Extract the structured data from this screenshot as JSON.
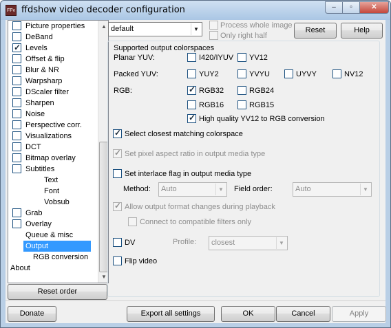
{
  "window": {
    "title": "ffdshow video decoder configuration",
    "icon_text": "FFv",
    "minimize": "–",
    "maximize": "▫",
    "close": "✕"
  },
  "tree": {
    "items": [
      {
        "label": "Picture properties",
        "checkbox": true,
        "checked": false
      },
      {
        "label": "DeBand",
        "checkbox": true,
        "checked": false
      },
      {
        "label": "Levels",
        "checkbox": true,
        "checked": true
      },
      {
        "label": "Offset & flip",
        "checkbox": true,
        "checked": false
      },
      {
        "label": "Blur & NR",
        "checkbox": true,
        "checked": false
      },
      {
        "label": "Warpsharp",
        "checkbox": true,
        "checked": false
      },
      {
        "label": "DScaler filter",
        "checkbox": true,
        "checked": false
      },
      {
        "label": "Sharpen",
        "checkbox": true,
        "checked": false
      },
      {
        "label": "Noise",
        "checkbox": true,
        "checked": false
      },
      {
        "label": "Perspective corr.",
        "checkbox": true,
        "checked": false
      },
      {
        "label": "Visualizations",
        "checkbox": true,
        "checked": false
      },
      {
        "label": "DCT",
        "checkbox": true,
        "checked": false
      },
      {
        "label": "Bitmap overlay",
        "checkbox": true,
        "checked": false
      },
      {
        "label": "Subtitles",
        "checkbox": true,
        "checked": false
      },
      {
        "label": "Text",
        "checkbox": false
      },
      {
        "label": "Font",
        "checkbox": false
      },
      {
        "label": "Vobsub",
        "checkbox": false
      },
      {
        "label": "Grab",
        "checkbox": true,
        "checked": false
      },
      {
        "label": "Overlay",
        "checkbox": true,
        "checked": false
      },
      {
        "label": "Queue & misc",
        "checkbox": false
      },
      {
        "label": "Output",
        "checkbox": false,
        "selected": true
      },
      {
        "label": "RGB conversion",
        "checkbox": false
      },
      {
        "label": "About",
        "checkbox": false
      }
    ],
    "scroll_up": "▲",
    "scroll_down": "▼"
  },
  "buttons": {
    "reset_order": "Reset order",
    "reset": "Reset",
    "help": "Help",
    "donate": "Donate",
    "export_all": "Export all settings",
    "ok": "OK",
    "cancel": "Cancel",
    "apply": "Apply"
  },
  "preset": {
    "value": "default",
    "arrow": "▼"
  },
  "options": {
    "process_whole_image": "Process whole image",
    "only_right_half": "Only right half"
  },
  "colorspaces": {
    "title": "Supported output colorspaces",
    "planar_label": "Planar YUV:",
    "packed_label": "Packed YUV:",
    "rgb_label": "RGB:",
    "i420": {
      "label": "I420/IYUV",
      "checked": false
    },
    "yv12": {
      "label": "YV12",
      "checked": false
    },
    "yuy2": {
      "label": "YUY2",
      "checked": false
    },
    "yvyu": {
      "label": "YVYU",
      "checked": false
    },
    "uyvy": {
      "label": "UYVY",
      "checked": false
    },
    "nv12": {
      "label": "NV12",
      "checked": false
    },
    "rgb32": {
      "label": "RGB32",
      "checked": true
    },
    "rgb24": {
      "label": "RGB24",
      "checked": false
    },
    "rgb16": {
      "label": "RGB16",
      "checked": false
    },
    "rgb15": {
      "label": "RGB15",
      "checked": false
    },
    "hq_yv12": {
      "label": "High quality YV12 to RGB conversion",
      "checked": true
    }
  },
  "settings": {
    "select_closest": {
      "label": "Select closest matching colorspace",
      "checked": true
    },
    "pixel_aspect": {
      "label": "Set pixel aspect ratio in output media type",
      "checked": true
    },
    "interlace": {
      "label": "Set interlace flag in output media type",
      "checked": false
    },
    "method_label": "Method:",
    "method_value": "Auto",
    "field_order_label": "Field order:",
    "field_order_value": "Auto",
    "allow_changes": {
      "label": "Allow output format changes during playback",
      "checked": true
    },
    "connect_compat": {
      "label": "Connect to compatible filters only",
      "checked": false
    },
    "dv": {
      "label": "DV",
      "checked": false
    },
    "profile_label": "Profile:",
    "profile_value": "closest",
    "flip": {
      "label": "Flip video",
      "checked": false
    }
  }
}
